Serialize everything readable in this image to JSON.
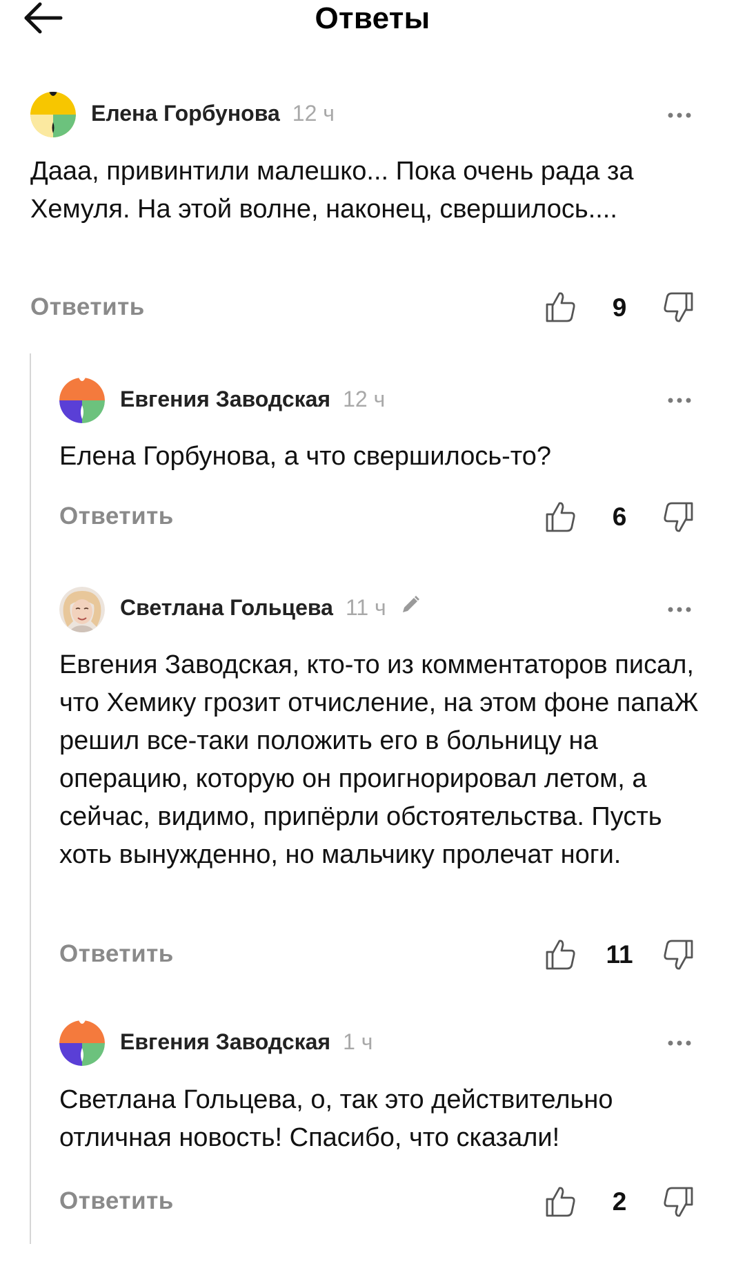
{
  "header": {
    "title": "Ответы",
    "back_icon": "arrow-left-icon"
  },
  "reply_label": "Ответить",
  "comments": [
    {
      "author": "Елена Горбунова",
      "time": "12 ч",
      "text": "Дааа, привинтили малешко... Пока очень рада за Хемуля. На этой волне, наконец, свершилось....",
      "likes": "9",
      "avatar": "flower-avatar-yellow"
    },
    {
      "author": "Евгения Заводская",
      "time": "12 ч",
      "text": "Елена Горбунова, а что свершилось-то?",
      "likes": "6",
      "avatar": "flower-avatar-orange"
    },
    {
      "author": "Светлана Гольцева",
      "time": "11 ч",
      "edited_icon": "pencil-icon",
      "text": "Евгения Заводская, кто-то из комментаторов писал, что Хемику грозит отчисление, на этом фоне папаЖ решил все-таки положить его в больницу на операцию, которую он проигнорировал летом, а сейчас, видимо, припёрли обстоятельства. Пусть хоть вынужденно, но мальчику пролечат ноги.",
      "likes": "11",
      "avatar": "photo-avatar"
    },
    {
      "author": "Евгения Заводская",
      "time": "1 ч",
      "text": "Светлана Гольцева, о, так это действительно отличная новость! Спасибо, что сказали!",
      "likes": "2",
      "avatar": "flower-avatar-orange"
    }
  ],
  "colors": {
    "author": "#222222",
    "time": "#a8a8a8",
    "reply": "#8a8a8a",
    "thread_line": "#d6d6d6",
    "avatar_yellow": "#f7c600",
    "avatar_orange": "#f47a3d",
    "avatar_purple": "#5a3fd6",
    "avatar_green": "#6cc27d"
  }
}
